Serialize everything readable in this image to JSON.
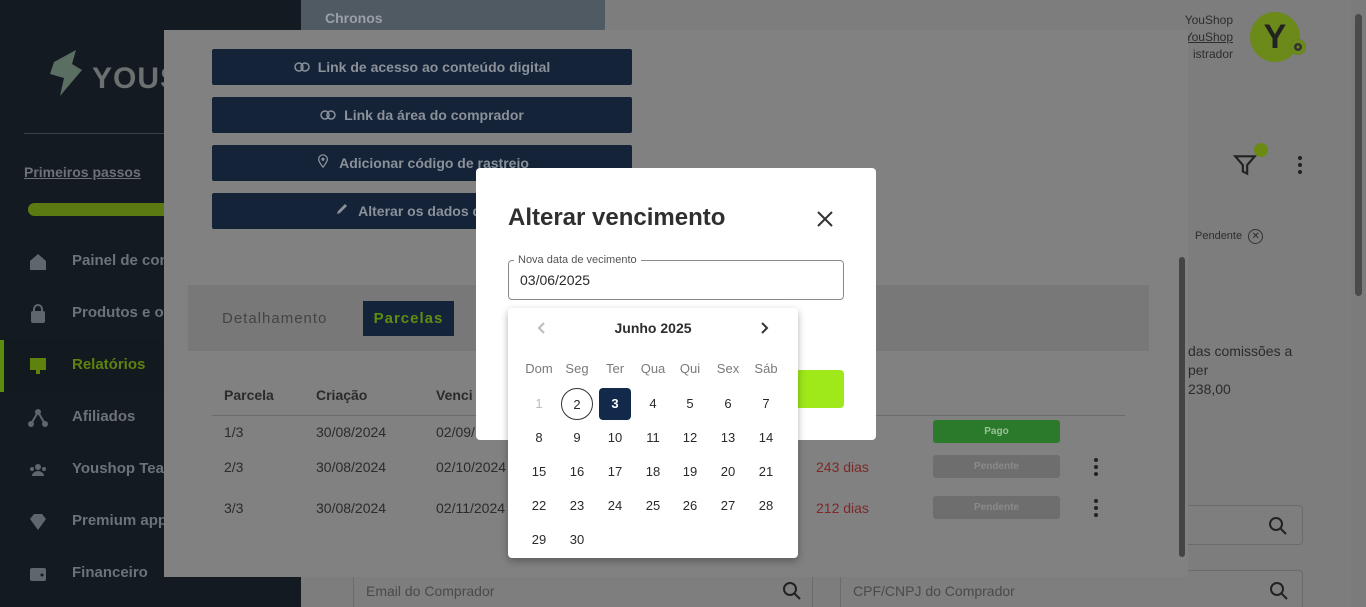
{
  "sidebar": {
    "logo_text": "YOUS",
    "primeiros_passos": "Primeiros passos",
    "items": [
      {
        "label": "Painel de cont",
        "icon": "home-icon"
      },
      {
        "label": "Produtos e of",
        "icon": "bag-icon"
      },
      {
        "label": "Relatórios",
        "icon": "report-icon",
        "active": true
      },
      {
        "label": "Afiliados",
        "icon": "network-icon"
      },
      {
        "label": "Youshop Tean",
        "icon": "team-icon"
      },
      {
        "label": "Premium app",
        "icon": "diamond-icon"
      },
      {
        "label": "Financeiro",
        "icon": "wallet-icon"
      }
    ]
  },
  "header": {
    "thumbnail_title": "Chronos",
    "user_name": "YouShop",
    "user_link": "YouShop",
    "user_role": "istrador",
    "avatar_letter": "Y"
  },
  "filters": {
    "chip": "Pendente",
    "commission_line1": "das comissões a",
    "commission_line2": "per",
    "commission_value": "238,00",
    "email_placeholder": "Email do Comprador",
    "cpf_placeholder": "CPF/CNPJ do Comprador"
  },
  "order_dialog": {
    "buttons": [
      {
        "label": "Link de acesso ao conteúdo digital",
        "icon": "link-icon"
      },
      {
        "label": "Link da área do comprador",
        "icon": "link-icon"
      },
      {
        "label": "Adicionar código de rastreio",
        "icon": "location-pin-icon"
      },
      {
        "label": "Alterar os dados do co",
        "icon": "pencil-icon"
      }
    ],
    "tabs": [
      "Detalhamento",
      "Parcelas"
    ],
    "columns": [
      "Parcela",
      "Criação",
      "Venci"
    ],
    "rows": [
      {
        "parcela": "1/3",
        "criacao": "30/08/2024",
        "venc": "02/09/",
        "dias": "",
        "status": "Pago"
      },
      {
        "parcela": "2/3",
        "criacao": "30/08/2024",
        "venc": "02/10/2024",
        "dias": "243 dias",
        "status": "Pendente"
      },
      {
        "parcela": "3/3",
        "criacao": "30/08/2024",
        "venc": "02/11/2024",
        "dias": "212 dias",
        "status": "Pendente"
      }
    ]
  },
  "due_dialog": {
    "title": "Alterar vencimento",
    "field_label": "Nova data de vecimento",
    "field_value": "03/06/2025",
    "calendar": {
      "month_label": "Junho 2025",
      "weekdays": [
        "Dom",
        "Seg",
        "Ter",
        "Qua",
        "Qui",
        "Sex",
        "Sáb"
      ],
      "weeks": [
        [
          "1",
          "2",
          "3",
          "4",
          "5",
          "6",
          "7"
        ],
        [
          "8",
          "9",
          "10",
          "11",
          "12",
          "13",
          "14"
        ],
        [
          "15",
          "16",
          "17",
          "18",
          "19",
          "20",
          "21"
        ],
        [
          "22",
          "23",
          "24",
          "25",
          "26",
          "27",
          "28"
        ],
        [
          "29",
          "30"
        ]
      ],
      "disabled_day": "1",
      "today_day": "2",
      "selected_day": "3"
    }
  },
  "colors": {
    "navy": "#13294b",
    "accent_green": "#9fe81a",
    "paid_green": "#3aa33a"
  }
}
